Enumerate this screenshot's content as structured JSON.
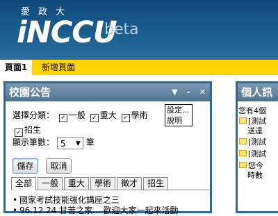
{
  "header": {
    "logo_top": "愛政大",
    "logo_main": "iNCCU",
    "logo_beta": "beta"
  },
  "tabs": {
    "active": "頁面1",
    "add": "新增頁面"
  },
  "panel": {
    "title": "校園公告",
    "controls": [
      "▼",
      "–",
      "✕"
    ],
    "category_label": "選擇分類：",
    "categories": [
      {
        "label": "一般",
        "checked": true
      },
      {
        "label": "重大",
        "checked": true
      },
      {
        "label": "學術",
        "checked": true
      },
      {
        "label": "招生",
        "checked": true
      }
    ],
    "count_label": "顯示筆數：",
    "count_value": "5",
    "count_unit": "筆",
    "save_label": "儲存",
    "cancel_label": "取消",
    "filter_tabs": [
      "全部",
      "一般",
      "重大",
      "學術",
      "徵才",
      "招生"
    ],
    "active_filter": "全部",
    "news": [
      "國家考試技能強化講座之三",
      "96.12.24 甘苦之家... 歡迎大家一起來活動"
    ]
  },
  "popup_menu": {
    "items": [
      "設定...",
      "說明"
    ]
  },
  "right_panel": {
    "title": "個人訊",
    "summary": "您有4個",
    "items": [
      {
        "text": "[測試",
        "sub": "送達"
      },
      {
        "text": "[測試",
        "sub": ""
      },
      {
        "text": "[測試",
        "sub": ""
      },
      {
        "text": "您今",
        "sub": "時數"
      }
    ]
  }
}
